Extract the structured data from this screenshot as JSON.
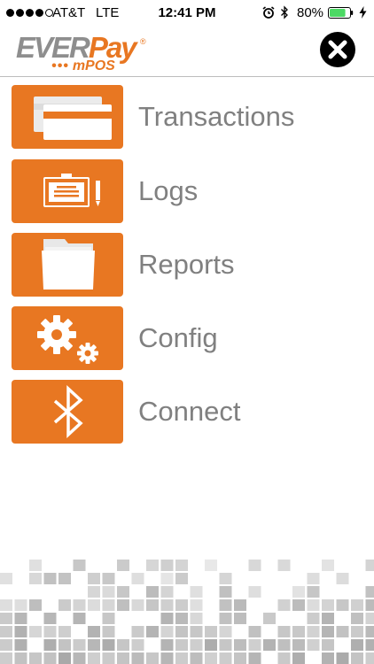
{
  "status_bar": {
    "carrier": "AT&T",
    "network": "LTE",
    "time": "12:41 PM",
    "battery_percent": "80%",
    "battery_level": 0.8,
    "signal_bars_filled": 4,
    "signal_bars_total": 5,
    "icons": [
      "alarm-icon",
      "bluetooth-icon",
      "battery-icon",
      "charging-icon"
    ]
  },
  "header": {
    "logo_primary_left": "EVER",
    "logo_primary_right": "Pay",
    "logo_registered": "®",
    "logo_dots": "•••",
    "logo_secondary": "mPOS",
    "close_icon": "close-icon"
  },
  "menu": {
    "items": [
      {
        "label": "Transactions",
        "icon": "cards-icon"
      },
      {
        "label": "Logs",
        "icon": "receipt-pen-icon"
      },
      {
        "label": "Reports",
        "icon": "folder-icon"
      },
      {
        "label": "Config",
        "icon": "gears-icon"
      },
      {
        "label": "Connect",
        "icon": "bluetooth-icon"
      }
    ]
  },
  "colors": {
    "brand_orange": "#e87722",
    "logo_gray": "#8e8e8e",
    "label_gray": "#808080",
    "battery_green": "#4cd964"
  }
}
